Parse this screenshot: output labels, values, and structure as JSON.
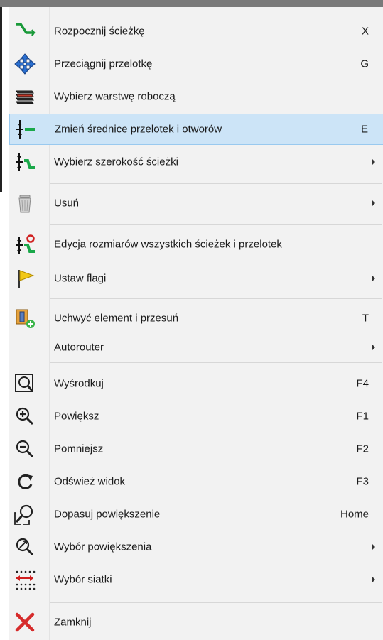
{
  "menu": {
    "items": [
      {
        "label": "Rozpocznij ścieżkę",
        "shortcut": "X"
      },
      {
        "label": "Przeciągnij przelotkę",
        "shortcut": "G"
      },
      {
        "label": "Wybierz warstwę roboczą",
        "shortcut": ""
      },
      {
        "label": "Zmień średnice przelotek i otworów",
        "shortcut": "E"
      },
      {
        "label": "Wybierz szerokość ścieżki",
        "shortcut": ""
      },
      {
        "label": "Usuń",
        "shortcut": ""
      },
      {
        "label": "Edycja rozmiarów wszystkich ścieżek i przelotek",
        "shortcut": ""
      },
      {
        "label": "Ustaw flagi",
        "shortcut": ""
      },
      {
        "label": "Uchwyć element i przesuń",
        "shortcut": "T"
      },
      {
        "label": "Autorouter",
        "shortcut": ""
      },
      {
        "label": "Wyśrodkuj",
        "shortcut": "F4"
      },
      {
        "label": "Powiększ",
        "shortcut": "F1"
      },
      {
        "label": "Pomniejsz",
        "shortcut": "F2"
      },
      {
        "label": "Odśwież widok",
        "shortcut": "F3"
      },
      {
        "label": "Dopasuj powiększenie",
        "shortcut": "Home"
      },
      {
        "label": "Wybór powiększenia",
        "shortcut": ""
      },
      {
        "label": "Wybór siatki",
        "shortcut": ""
      },
      {
        "label": "Zamknij",
        "shortcut": ""
      }
    ]
  },
  "colors": {
    "highlight": "#cce4f7",
    "highlight_border": "#99c9ef",
    "menu_bg": "#f2f2f2"
  }
}
